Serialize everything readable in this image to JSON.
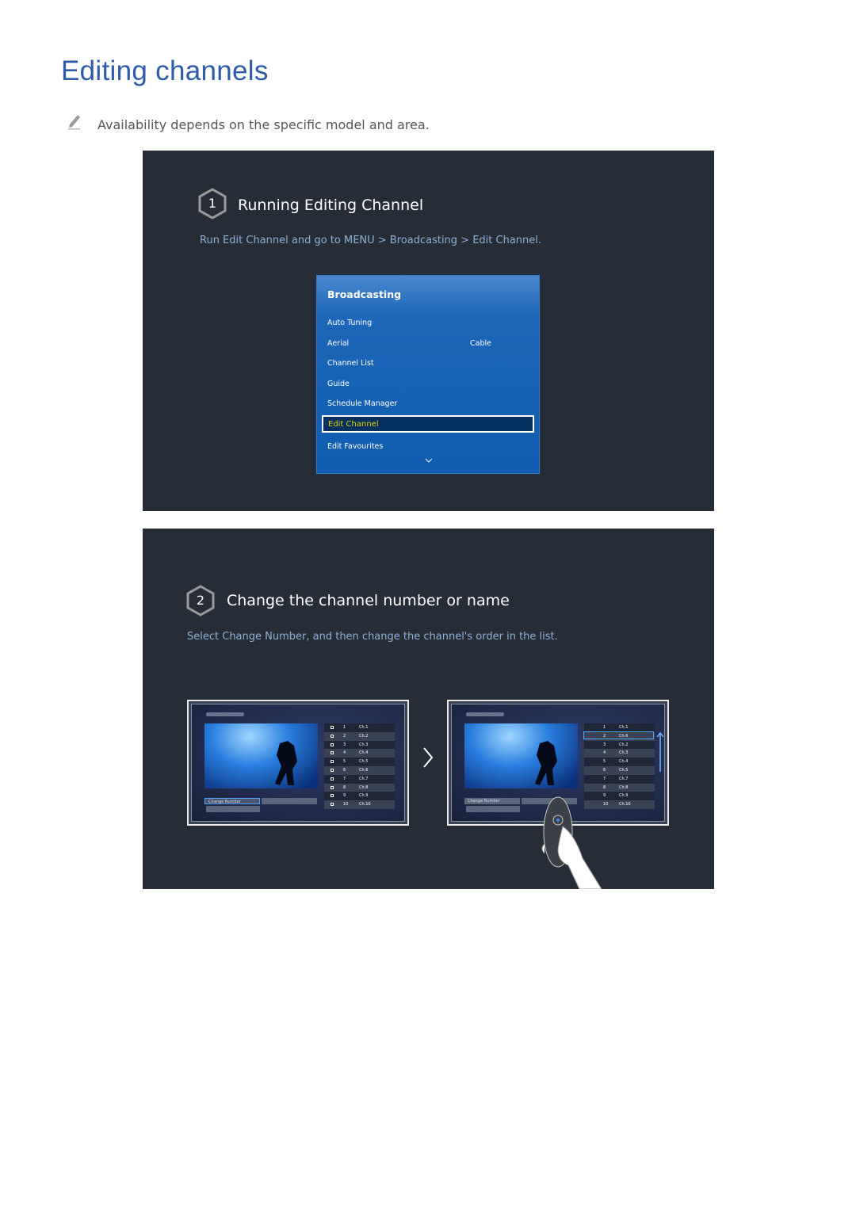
{
  "page": {
    "title": "Editing channels",
    "note": "Availability depends on the specific model and area."
  },
  "step1": {
    "number": "1",
    "title": "Running Editing Channel",
    "desc": "Run Edit Channel and go to MENU > Broadcasting > Edit Channel.",
    "menu": {
      "title": "Broadcasting",
      "items": [
        "Auto Tuning",
        "Aerial",
        "Channel List",
        "Guide",
        "Schedule Manager",
        "Edit Channel",
        "Edit Favourites"
      ],
      "aerial_value": "Cable",
      "selected": "Edit Channel"
    }
  },
  "step2": {
    "number": "2",
    "title": "Change the channel number or name",
    "desc": "Select Change Number, and then change the channel's order in the list.",
    "before": {
      "button": "Change Number",
      "rows": [
        [
          "1",
          "Ch.1"
        ],
        [
          "2",
          "Ch.2"
        ],
        [
          "3",
          "Ch.3"
        ],
        [
          "4",
          "Ch.4"
        ],
        [
          "5",
          "Ch.5"
        ],
        [
          "6",
          "Ch.6"
        ],
        [
          "7",
          "Ch.7"
        ],
        [
          "8",
          "Ch.8"
        ],
        [
          "9",
          "Ch.9"
        ],
        [
          "10",
          "Ch.10"
        ]
      ]
    },
    "after": {
      "button": "Change Number",
      "rows": [
        [
          "1",
          "Ch.1"
        ],
        [
          "2",
          "Ch.6"
        ],
        [
          "3",
          "Ch.2"
        ],
        [
          "4",
          "Ch.3"
        ],
        [
          "5",
          "Ch.4"
        ],
        [
          "6",
          "Ch.5"
        ],
        [
          "7",
          "Ch.7"
        ],
        [
          "8",
          "Ch.8"
        ],
        [
          "9",
          "Ch.9"
        ],
        [
          "10",
          "Ch.10"
        ]
      ]
    }
  },
  "colors": {
    "title": "#2f5aa8",
    "panel": "#262d37",
    "menu": "#0f5cb0",
    "highlight": "#e6d300"
  }
}
